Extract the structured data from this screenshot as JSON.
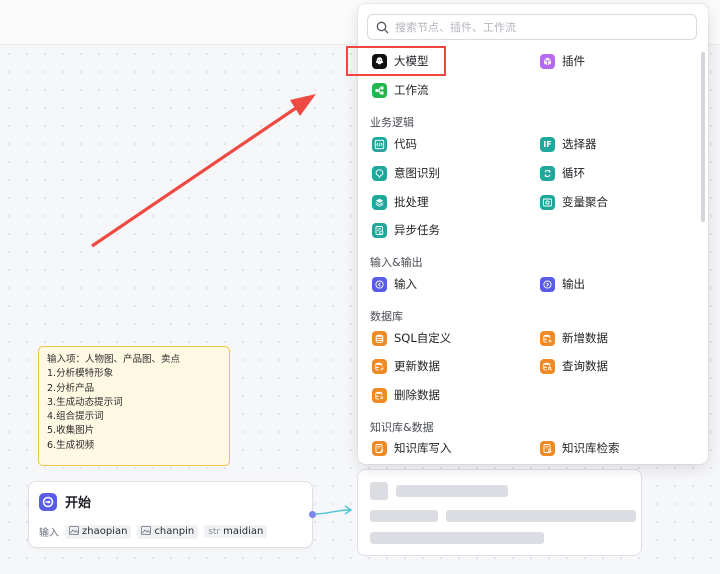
{
  "search": {
    "placeholder": "搜索节点、插件、工作流"
  },
  "top_items": [
    {
      "label": "大模型",
      "icon": "llm-icon",
      "color": "#111111"
    },
    {
      "label": "插件",
      "icon": "plugin-icon",
      "color": "#b56af0"
    },
    {
      "label": "工作流",
      "icon": "workflow-icon",
      "color": "#23b64e"
    }
  ],
  "sections": {
    "business": "业务逻辑",
    "io": "输入&输出",
    "database": "数据库",
    "knowledge": "知识库&数据"
  },
  "business_items": [
    {
      "label": "代码",
      "icon": "code-icon"
    },
    {
      "label": "选择器",
      "icon": "if-icon"
    },
    {
      "label": "意图识别",
      "icon": "intent-icon"
    },
    {
      "label": "循环",
      "icon": "loop-icon"
    },
    {
      "label": "批处理",
      "icon": "batch-icon"
    },
    {
      "label": "变量聚合",
      "icon": "aggregate-icon"
    },
    {
      "label": "异步任务",
      "icon": "async-task-icon"
    }
  ],
  "io_items": [
    {
      "label": "输入",
      "icon": "input-icon"
    },
    {
      "label": "输出",
      "icon": "output-icon"
    }
  ],
  "database_items": [
    {
      "label": "SQL自定义",
      "icon": "sql-icon"
    },
    {
      "label": "新增数据",
      "icon": "db-add-icon"
    },
    {
      "label": "更新数据",
      "icon": "db-update-icon"
    },
    {
      "label": "查询数据",
      "icon": "db-query-icon"
    },
    {
      "label": "删除数据",
      "icon": "db-delete-icon"
    }
  ],
  "knowledge_items": [
    {
      "label": "知识库写入",
      "icon": "kb-write-icon"
    },
    {
      "label": "知识库检索",
      "icon": "kb-search-icon"
    }
  ],
  "colors": {
    "teal": "#1fa99c",
    "indigo": "#5b5ce6",
    "orange": "#f08a24",
    "highlight": "#f0463f",
    "note_bg": "#fff9e4",
    "note_border": "#f2c344"
  },
  "note": {
    "lines": [
      "输入项：人物图、产品图、卖点",
      "1.分析模特形象",
      "2.分析产品",
      "3.生成动态提示词",
      "4.组合提示词",
      "5.收集图片",
      "6.生成视频"
    ]
  },
  "start_node": {
    "title": "开始",
    "input_label": "输入",
    "inputs": [
      {
        "type_icon": "image-icon",
        "name": "zhaopian"
      },
      {
        "type_icon": "image-icon",
        "name": "chanpin"
      },
      {
        "type_prefix": "str",
        "name": "maidian"
      }
    ]
  }
}
